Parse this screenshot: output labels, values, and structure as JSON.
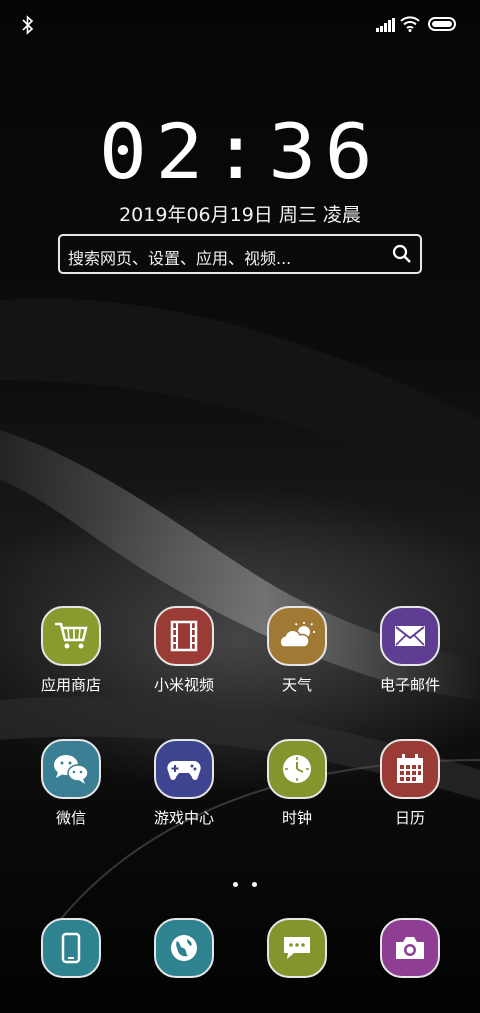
{
  "status_bar": {
    "left_icon": "bluetooth-icon",
    "right_icons": [
      "signal-icon",
      "wifi-icon",
      "battery-icon"
    ]
  },
  "lock": {
    "time": "02:36",
    "date": "2019年06月19日  周三 凌晨"
  },
  "search": {
    "placeholder": "搜索网页、设置、应用、视频...",
    "icon": "search-icon"
  },
  "apps": [
    {
      "label": "应用商店",
      "icon": "cart-icon",
      "color": "#8a9a2e"
    },
    {
      "label": "小米视频",
      "icon": "film-icon",
      "color": "#9a3b36"
    },
    {
      "label": "天气",
      "icon": "weather-icon",
      "color": "#a07a34"
    },
    {
      "label": "电子邮件",
      "icon": "mail-icon",
      "color": "#5e3d92"
    },
    {
      "label": "微信",
      "icon": "chat-icon",
      "color": "#3a7f94"
    },
    {
      "label": "游戏中心",
      "icon": "gamepad-icon",
      "color": "#3f4490"
    },
    {
      "label": "时钟",
      "icon": "clock-icon",
      "color": "#86942e"
    },
    {
      "label": "日历",
      "icon": "calendar-icon",
      "color": "#9a3b36"
    }
  ],
  "page_indicator": {
    "count": 2,
    "current": 1
  },
  "dock": [
    {
      "icon": "phone-icon",
      "color": "#2f8290"
    },
    {
      "icon": "browser-icon",
      "color": "#2f8290"
    },
    {
      "icon": "message-icon",
      "color": "#86942e"
    },
    {
      "icon": "camera-icon",
      "color": "#8e3f94"
    }
  ]
}
